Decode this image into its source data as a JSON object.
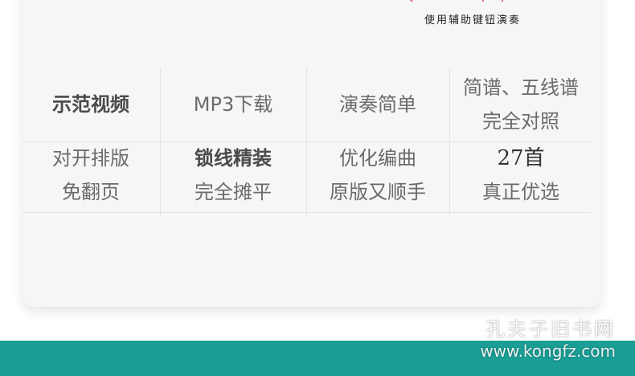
{
  "caption": "使用辅助键钮演奏",
  "features": {
    "row1": [
      {
        "lines": [
          "示范视频"
        ],
        "style": "bold"
      },
      {
        "lines": [
          "MP3下载"
        ],
        "style": "normal"
      },
      {
        "lines": [
          "演奏简单"
        ],
        "style": "normal"
      },
      {
        "lines": [
          "简谱、五线谱",
          "完全对照"
        ],
        "style": "normal"
      }
    ],
    "row2": [
      {
        "lines": [
          "对开排版",
          "免翻页"
        ],
        "style": "normal"
      },
      {
        "lines": [
          "锁线精装",
          "完全摊平"
        ],
        "style": "bold-first"
      },
      {
        "lines": [
          "优化编曲",
          "原版又顺手"
        ],
        "style": "normal"
      },
      {
        "lines": [
          "27首",
          "真正优选"
        ],
        "style": "serif-first"
      }
    ]
  },
  "watermark": {
    "cn": "孔夫子旧书网",
    "url": "www.kongfz.com"
  },
  "colors": {
    "band": "#1a9e96",
    "accent_pink": "#e0407a"
  }
}
